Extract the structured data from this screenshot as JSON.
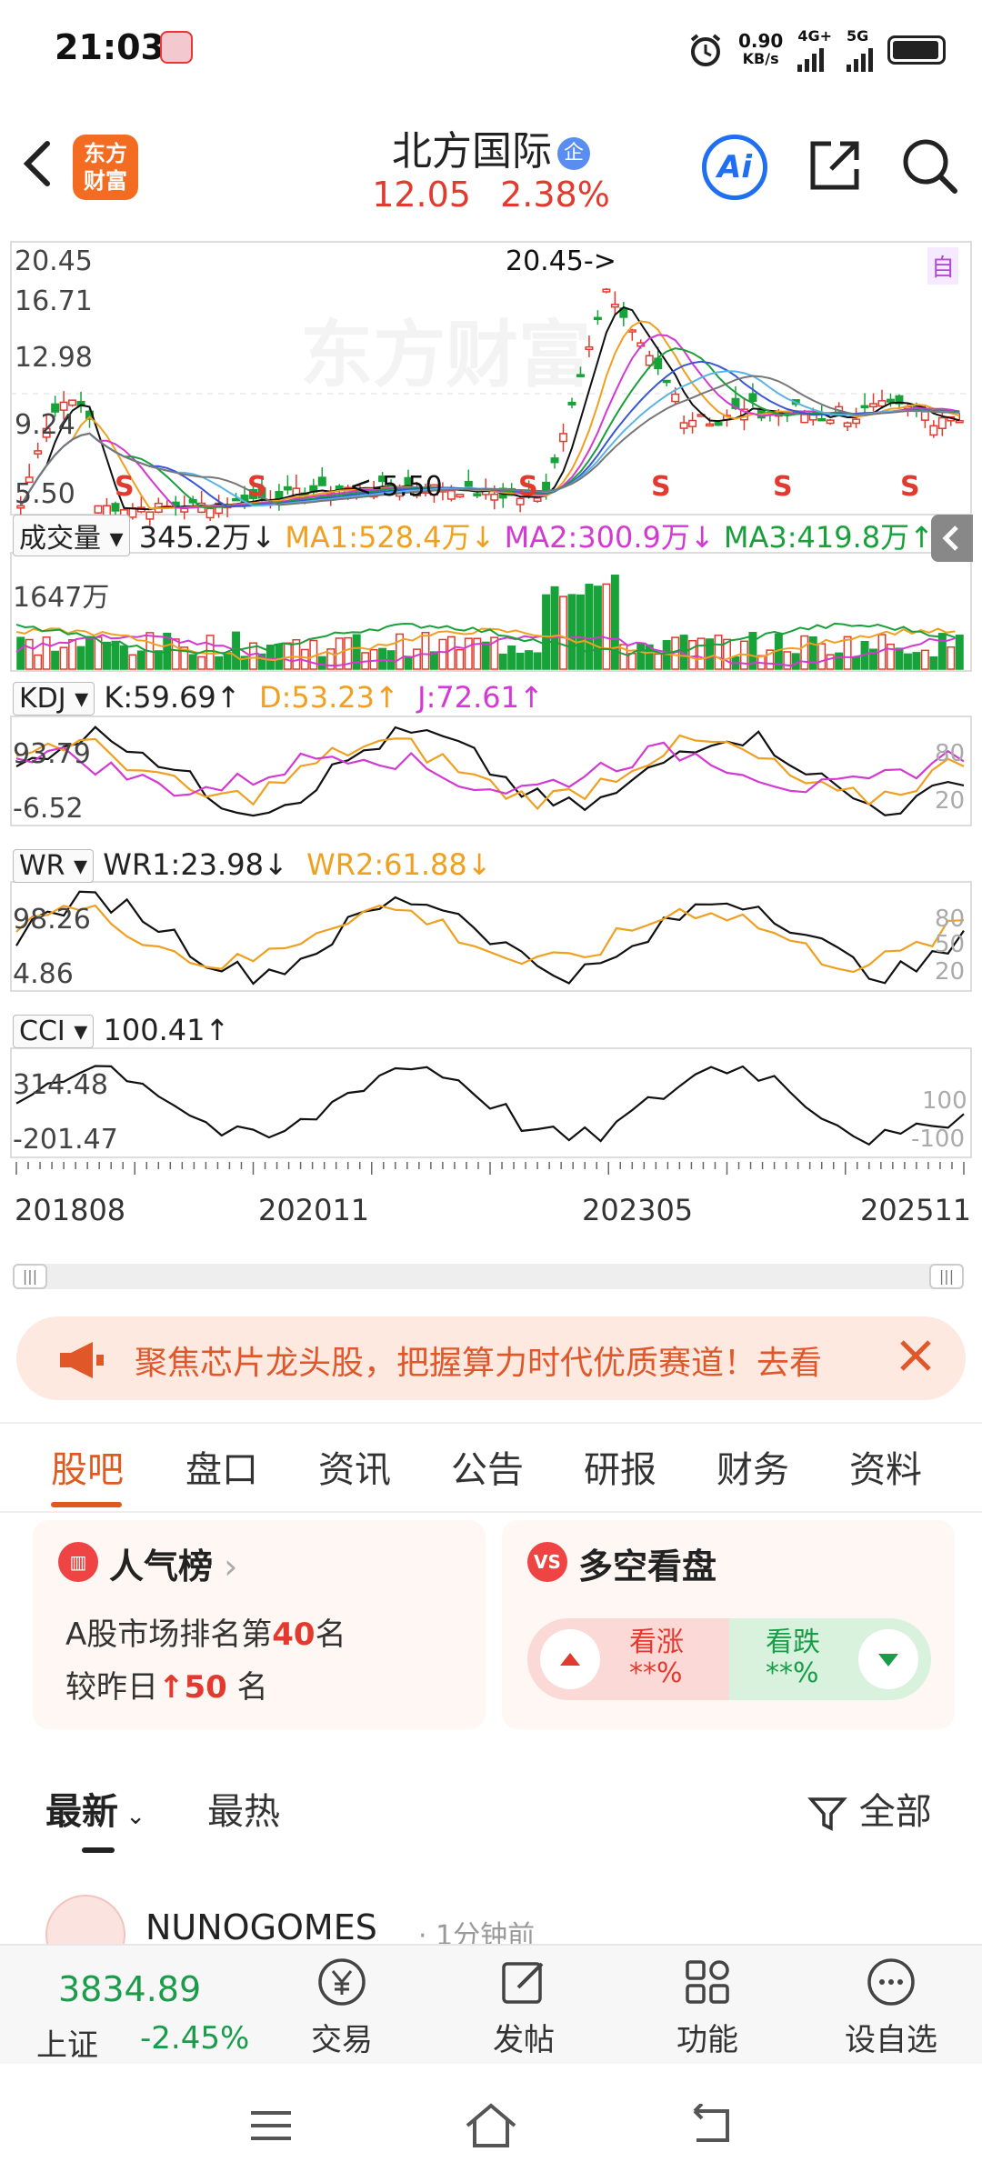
{
  "status": {
    "time": "21:03",
    "speed_value": "0.90",
    "speed_unit": "KB/s",
    "net1": "4G+",
    "net2": "5G"
  },
  "header": {
    "stock_name": "北方国际",
    "badge": "企",
    "price": "12.05",
    "change_pct": "2.38%",
    "ai_label": "Ai",
    "logo_text": "东方财富"
  },
  "chart": {
    "price_axis": [
      "20.45",
      "16.71",
      "12.98",
      "9.24",
      "5.50"
    ],
    "high_annotation": "20.45->",
    "low_annotation": "<-5.50",
    "self_tag": "自",
    "signal_letter": "S",
    "volume": {
      "label": "成交量",
      "value": "345.2万↓",
      "ma1": "MA1:528.4万↓",
      "ma2": "MA2:300.9万↓",
      "ma3": "MA3:419.8万↑",
      "max": "1647万"
    },
    "kdj": {
      "label": "KDJ",
      "k": "K:59.69↑",
      "d": "D:53.23↑",
      "j": "J:72.61↑",
      "max": "93.79",
      "min": "-6.52",
      "r80": "80",
      "r20": "20"
    },
    "wr": {
      "label": "WR",
      "wr1": "WR1:23.98↓",
      "wr2": "WR2:61.88↓",
      "max": "98.26",
      "min": "4.86",
      "r80": "80",
      "r50": "50",
      "r20": "20"
    },
    "cci": {
      "label": "CCI",
      "value": "100.41↑",
      "max": "314.48",
      "min": "-201.47",
      "p100": "100",
      "n100": "-100"
    },
    "time_axis": [
      "201808",
      "202011",
      "202305",
      "202511"
    ],
    "colors": {
      "up": "#e23a2e",
      "down": "#17a339",
      "ma_orange": "#f0a020",
      "ma_magenta": "#d23ad2",
      "ma_green": "#1aa03a"
    }
  },
  "banner": {
    "text": "聚焦芯片龙头股，把握算力时代优质赛道！去看"
  },
  "tabs": [
    "股吧",
    "盘口",
    "资讯",
    "公告",
    "研报",
    "财务",
    "资料"
  ],
  "cards": {
    "popularity": {
      "title": "人气榜",
      "line1_prefix": "A股市场排名第",
      "rank": "40",
      "line1_suffix": "名",
      "line2_prefix": "较昨日",
      "delta": "50",
      "line2_suffix": " 名"
    },
    "longshort": {
      "title": "多空看盘",
      "up_label": "看涨",
      "up_val": "**%",
      "down_label": "看跌",
      "down_val": "**%"
    }
  },
  "feed": {
    "filter_latest": "最新",
    "filter_hot": "最热",
    "filter_all": "全部",
    "post_user": "NUNOGOMES",
    "post_time": "· 1分钟前"
  },
  "bottom": {
    "index_value": "3834.89",
    "index_name": "上证",
    "index_change": "-2.45%",
    "trade": "交易",
    "post": "发帖",
    "func": "功能",
    "watch": "设自选"
  }
}
